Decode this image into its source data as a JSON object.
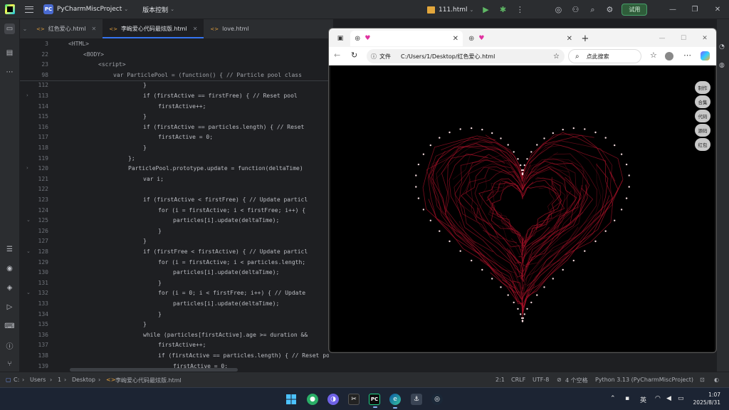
{
  "titlebar": {
    "project_badge": "PC",
    "project_name": "PyCharmMiscProject",
    "vcs_label": "版本控制",
    "run_config": "111.html",
    "trial_label": "试用"
  },
  "editor_tabs": [
    {
      "label": "红色爱心.html",
      "active": false
    },
    {
      "label": "李峋爱心代码最炫版.html",
      "active": true
    },
    {
      "label": "love.html",
      "active": false
    }
  ],
  "editor": {
    "lines": [
      {
        "n": "3",
        "text": "<HTML>",
        "indent": 0
      },
      {
        "n": "22",
        "text": "<BODY>",
        "indent": 1
      },
      {
        "n": "23",
        "text": "<script>",
        "indent": 2
      },
      {
        "n": "98",
        "text": "var ParticlePool = (function() { // Particle pool class",
        "indent": 3
      },
      {
        "n": "112",
        "text": "}",
        "indent": 5
      },
      {
        "n": "113",
        "text": "if (firstActive == firstFree) { // Reset pool",
        "indent": 5
      },
      {
        "n": "114",
        "text": "firstActive++;",
        "indent": 6
      },
      {
        "n": "115",
        "text": "}",
        "indent": 5
      },
      {
        "n": "116",
        "text": "if (firstActive == particles.length) { // Reset",
        "indent": 5
      },
      {
        "n": "117",
        "text": "firstActive = 0;",
        "indent": 6
      },
      {
        "n": "118",
        "text": "}",
        "indent": 5
      },
      {
        "n": "119",
        "text": "};",
        "indent": 4
      },
      {
        "n": "120",
        "text": "ParticlePool.prototype.update = function(deltaTime)",
        "indent": 4
      },
      {
        "n": "121",
        "text": "var i;",
        "indent": 5
      },
      {
        "n": "122",
        "text": "",
        "indent": 5
      },
      {
        "n": "123",
        "text": "if (firstActive < firstFree) { // Update particl",
        "indent": 5
      },
      {
        "n": "124",
        "text": "for (i = firstActive; i < firstFree; i++) {",
        "indent": 6
      },
      {
        "n": "125",
        "text": "particles[i].update(deltaTime);",
        "indent": 7
      },
      {
        "n": "126",
        "text": "}",
        "indent": 6
      },
      {
        "n": "127",
        "text": "}",
        "indent": 5
      },
      {
        "n": "128",
        "text": "if (firstFree < firstActive) { // Update particl",
        "indent": 5
      },
      {
        "n": "129",
        "text": "for (i = firstActive; i < particles.length;",
        "indent": 6
      },
      {
        "n": "130",
        "text": "particles[i].update(deltaTime);",
        "indent": 7
      },
      {
        "n": "131",
        "text": "}",
        "indent": 6
      },
      {
        "n": "132",
        "text": "for (i = 0; i < firstFree; i++) { // Update",
        "indent": 6
      },
      {
        "n": "133",
        "text": "particles[i].update(deltaTime);",
        "indent": 7
      },
      {
        "n": "134",
        "text": "}",
        "indent": 6
      },
      {
        "n": "135",
        "text": "}",
        "indent": 5
      },
      {
        "n": "136",
        "text": "while (particles[firstActive].age >= duration &&",
        "indent": 5
      },
      {
        "n": "137",
        "text": "firstActive++;",
        "indent": 6
      },
      {
        "n": "138",
        "text": "if (firstActive == particles.length) { // Reset pool",
        "indent": 6
      },
      {
        "n": "139",
        "text": "firstActive = 0;",
        "indent": 7
      }
    ]
  },
  "browser": {
    "tabs": [
      {
        "title": "",
        "active": true
      },
      {
        "title": "",
        "active": false
      }
    ],
    "file_label": "文件",
    "url": "C:/Users/1/Desktop/红色爱心.html",
    "search_placeholder": "点此搜索",
    "side_buttons": [
      "制作",
      "合集",
      "代码",
      "源码",
      "红包"
    ]
  },
  "statusbar": {
    "breadcrumb": [
      "C:",
      "Users",
      "1",
      "Desktop",
      "李峋爱心代码最炫版.html"
    ],
    "position": "2:1",
    "line_ending": "CRLF",
    "encoding": "UTF-8",
    "indent": "4 个空格",
    "interpreter": "Python 3.13 (PyCharmMiscProject)"
  },
  "taskbar": {
    "ime": "英",
    "time": "1:07",
    "date": "2025/8/31"
  },
  "colors": {
    "ide_bg": "#1e1f22",
    "ide_panel": "#2b2d30",
    "accent": "#3574f0",
    "heart_red": "#b3132b"
  }
}
